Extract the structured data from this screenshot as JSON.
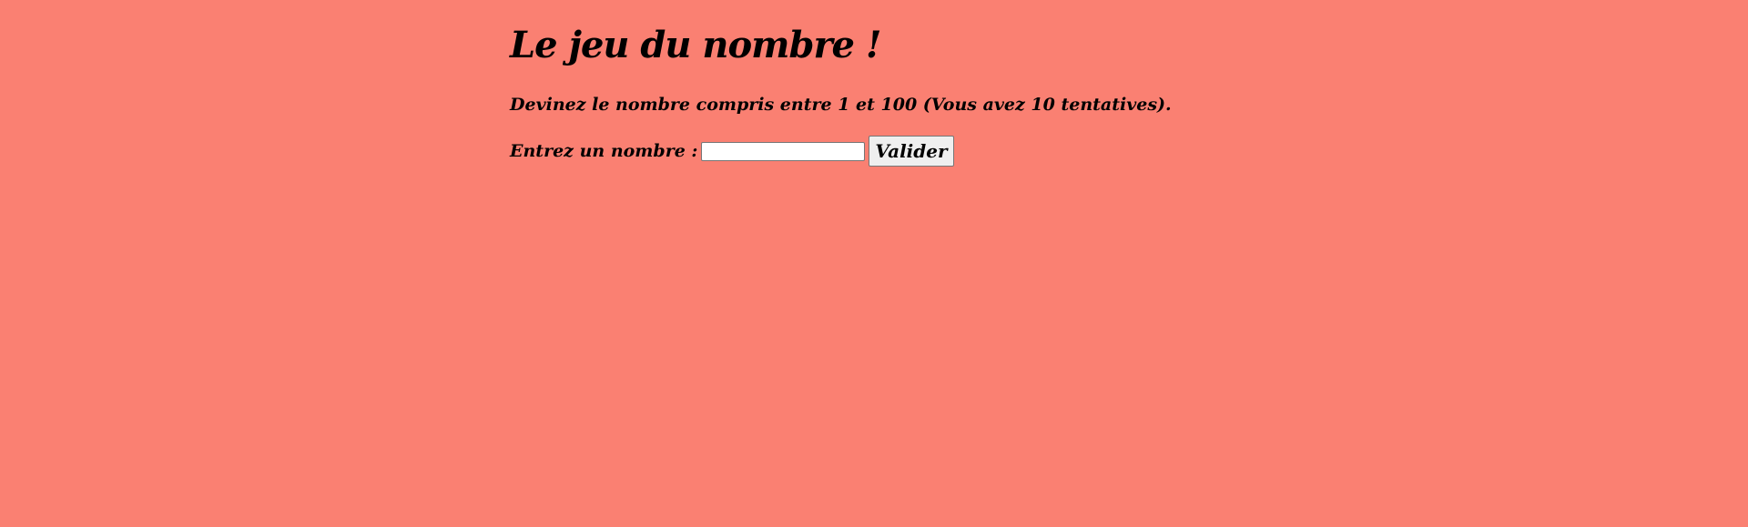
{
  "page": {
    "background": "#FA8072",
    "title": "Le jeu du nombre !",
    "instructions": "Devinez le nombre compris entre 1 et 100 (Vous avez 10 tentatives)."
  },
  "form": {
    "label": "Entrez un nombre :",
    "input_value": "",
    "input_placeholder": "",
    "submit_label": "Valider"
  }
}
